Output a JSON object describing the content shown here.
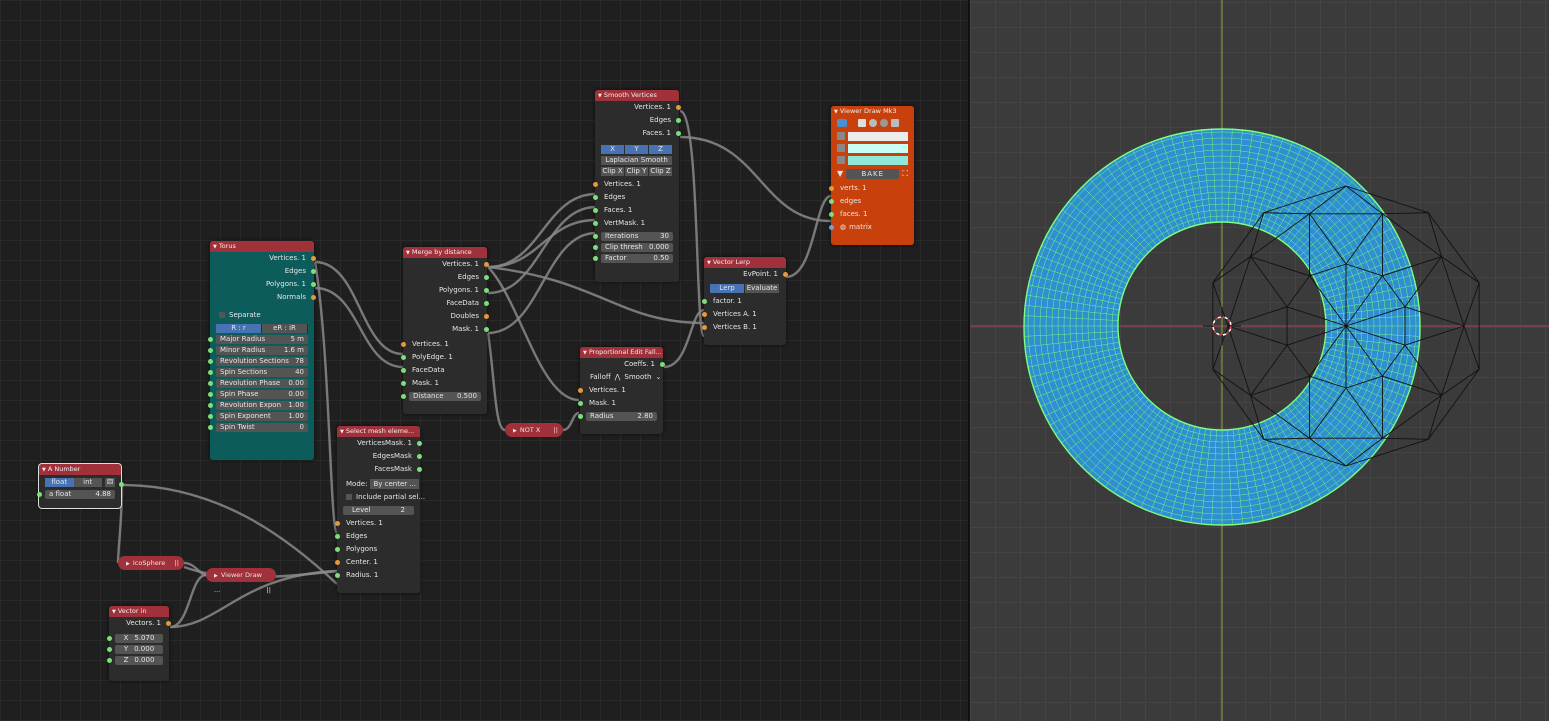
{
  "nodes": {
    "smooth": {
      "title": "Smooth Vertices",
      "outs": [
        "Vertices. 1",
        "Edges",
        "Faces. 1"
      ],
      "axes": [
        "X",
        "Y",
        "Z"
      ],
      "mode": "Laplacian Smooth",
      "clips": [
        "Clip X",
        "Clip Y",
        "Clip Z"
      ],
      "ins": [
        "Vertices. 1",
        "Edges",
        "Faces. 1",
        "VertMask. 1"
      ],
      "iterations": {
        "label": "Iterations",
        "value": "30"
      },
      "clip": {
        "label": "Clip thresh",
        "value": "0.000"
      },
      "factor": {
        "label": "Factor",
        "value": "0.50"
      }
    },
    "viewer": {
      "title": "Viewer Draw Mk3",
      "bake": "BAKE",
      "ins": [
        "verts. 1",
        "edges",
        "faces. 1",
        "matrix"
      ]
    },
    "torus": {
      "title": "Torus",
      "outs": [
        "Vertices. 1",
        "Edges",
        "Polygons. 1",
        "Normals"
      ],
      "separate": "Separate",
      "modes": [
        "R : r",
        "eR : iR"
      ],
      "fields": [
        {
          "label": "Major Radius",
          "value": "5 m"
        },
        {
          "label": "Minor Radius",
          "value": "1.6 m"
        },
        {
          "label": "Revolution Sections",
          "value": "78"
        },
        {
          "label": "Spin Sections",
          "value": "40"
        },
        {
          "label": "Revolution Phase",
          "value": "0.00"
        },
        {
          "label": "Spin Phase",
          "value": "0.00"
        },
        {
          "label": "Revolution Expon",
          "value": "1.00"
        },
        {
          "label": "Spin Exponent",
          "value": "1.00"
        },
        {
          "label": "Spin Twist",
          "value": "0"
        }
      ]
    },
    "merge": {
      "title": "Merge by distance",
      "outs": [
        "Vertices. 1",
        "Edges",
        "Polygons. 1",
        "FaceData",
        "Doubles",
        "Mask. 1"
      ],
      "ins": [
        "Vertices. 1",
        "PolyEdge. 1",
        "FaceData",
        "Mask. 1"
      ],
      "distance": {
        "label": "Distance",
        "value": "0.500"
      }
    },
    "lerp": {
      "title": "Vector Lerp",
      "out": "EvPoint. 1",
      "modes": [
        "Lerp",
        "Evaluate"
      ],
      "ins": [
        "factor. 1",
        "Vertices A. 1",
        "Vertices B. 1"
      ]
    },
    "prop": {
      "title": "Proportional Edit Fall...",
      "out": "Coeffs. 1",
      "falloff_label": "Falloff",
      "falloff_value": "Smooth",
      "ins": [
        "Vertices. 1",
        "Mask. 1"
      ],
      "radius": {
        "label": "Radius",
        "value": "2.80"
      }
    },
    "notx": {
      "title": "NOT X"
    },
    "select": {
      "title": "Select mesh eleme...",
      "outs": [
        "VerticesMask. 1",
        "EdgesMask",
        "FacesMask"
      ],
      "mode_label": "Mode:",
      "mode_value": "By center ...",
      "include": "Include partial sel...",
      "level": {
        "label": "Level",
        "value": "2"
      },
      "ins": [
        "Vertices. 1",
        "Edges",
        "Polygons",
        "Center. 1",
        "Radius. 1"
      ]
    },
    "anumber": {
      "title": "A Number",
      "modes": [
        "float",
        "int"
      ],
      "field": {
        "label": "a float",
        "value": "4.88"
      }
    },
    "ico": {
      "title": "IcoSphere"
    },
    "viewer2": {
      "title": "Viewer Draw ..."
    },
    "vecin": {
      "title": "Vector in",
      "out": "Vectors. 1",
      "fields": [
        {
          "label": "X",
          "value": "5.070"
        },
        {
          "label": "Y",
          "value": "0.000"
        },
        {
          "label": "Z",
          "value": "0.000"
        }
      ]
    }
  },
  "colors": {
    "node_red": "#a0303a",
    "torus": "#0d5c5c",
    "viewer": "#c8410c",
    "mesh_fill": "#2f8fd0",
    "wire": "#7cff7c"
  }
}
